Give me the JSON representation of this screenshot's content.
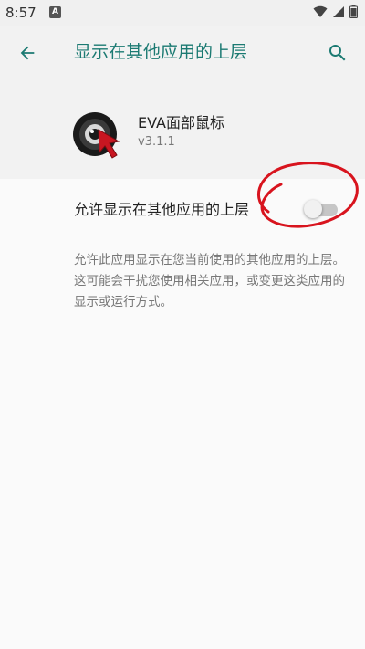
{
  "status_bar": {
    "time": "8:57",
    "notification_icon_text": "A",
    "icons": [
      "wifi-icon",
      "signal-icon",
      "battery-icon"
    ]
  },
  "header": {
    "title": "显示在其他应用的上层",
    "back_icon": "arrow-left-icon",
    "search_icon": "search-icon"
  },
  "app": {
    "name": "EVA面部鼠标",
    "version": "v3.1.1",
    "icon": "eva-app-logo"
  },
  "permission": {
    "label": "允许显示在其他应用的上层",
    "enabled": false,
    "description": "允许此应用显示在您当前使用的其他应用的上层。这可能会干扰您使用相关应用，或变更这类应用的显示或运行方式。"
  },
  "colors": {
    "accent": "#1b7a72",
    "annotation": "#d8141e",
    "background": "#fafafa",
    "header_bg": "#f2f2f2"
  }
}
